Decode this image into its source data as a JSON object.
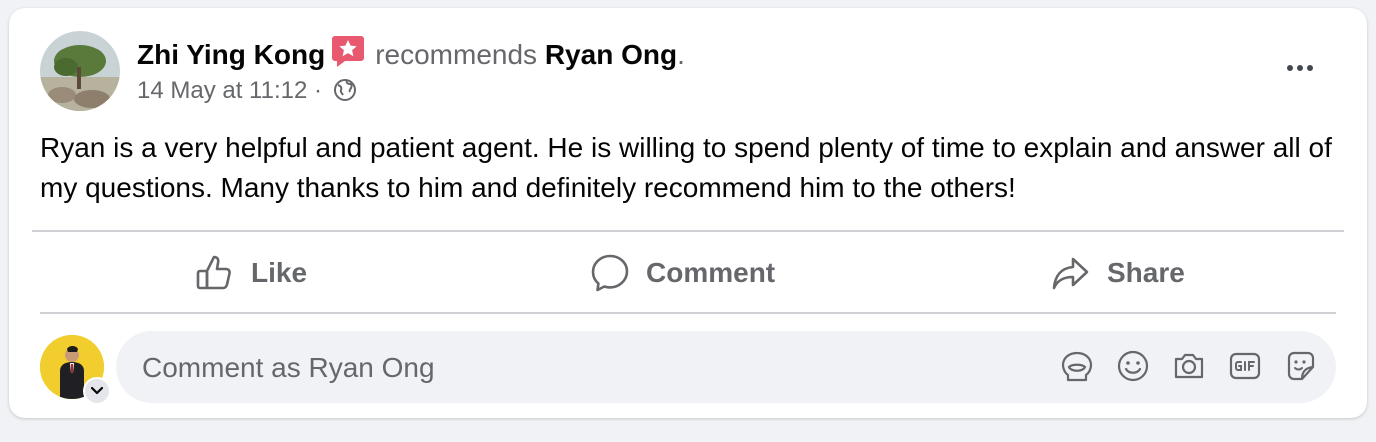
{
  "post": {
    "author": "Zhi Ying Kong",
    "verb": "recommends",
    "target": "Ryan Ong",
    "target_suffix": ".",
    "timestamp": "14 May at 11:12",
    "meta_separator": " · ",
    "audience_icon": "globe-icon",
    "text": "Ryan is a very helpful and patient agent. He is willing to spend plenty of time to explain and answer all of my questions. Many thanks to him and definitely recommend him to the others!"
  },
  "actions": {
    "like": "Like",
    "comment": "Comment",
    "share": "Share"
  },
  "composer": {
    "placeholder": "Comment as Ryan Ong",
    "tools": [
      "avatar-sticker-icon",
      "emoji-icon",
      "camera-icon",
      "gif-icon",
      "sticker-icon"
    ]
  },
  "colors": {
    "recommend_badge": "#e8596f",
    "secondary_text": "#65676b",
    "avatar_bg": "#f2cd2e"
  }
}
